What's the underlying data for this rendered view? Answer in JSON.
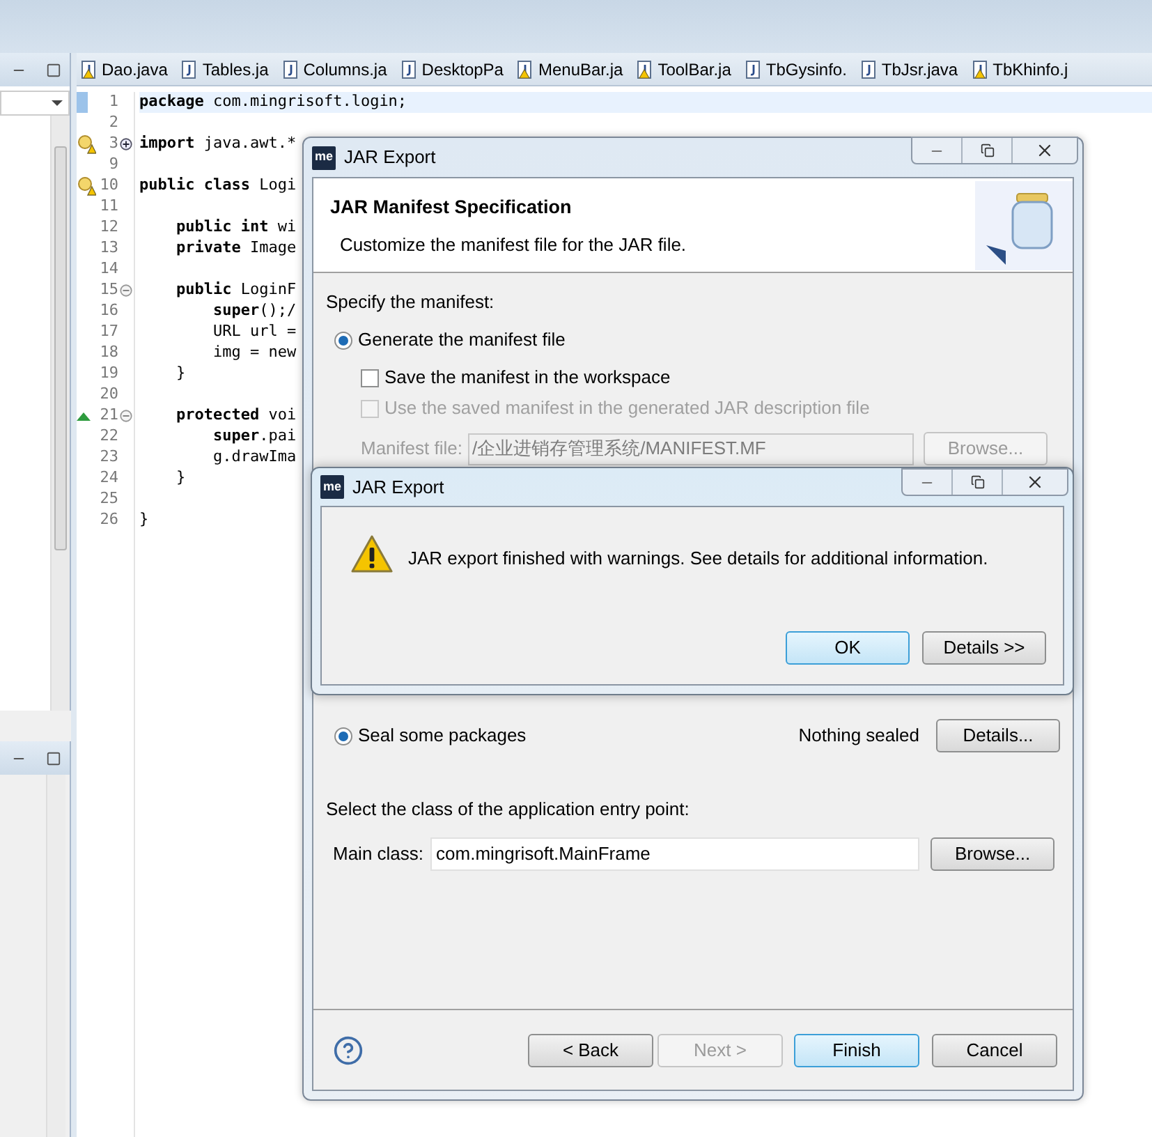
{
  "editor": {
    "tabs": [
      {
        "label": "Dao.java",
        "warning": true
      },
      {
        "label": "Tables.ja",
        "warning": false
      },
      {
        "label": "Columns.ja",
        "warning": false
      },
      {
        "label": "DesktopPa",
        "warning": false
      },
      {
        "label": "MenuBar.ja",
        "warning": true
      },
      {
        "label": "ToolBar.ja",
        "warning": true
      },
      {
        "label": "TbGysinfo.",
        "warning": false
      },
      {
        "label": "TbJsr.java",
        "warning": false
      },
      {
        "label": "TbKhinfo.j",
        "warning": true
      }
    ],
    "lines": [
      {
        "number": "1",
        "code": "**package** com.mingrisoft.login;",
        "highlighted": true,
        "warning": false,
        "override": false
      },
      {
        "number": "2",
        "highlighted": false,
        "warning": false,
        "override": false
      },
      {
        "number": "3",
        "code": "**import** java.awt.*",
        "highlighted": false,
        "warning": true,
        "override": false,
        "expanded": false
      },
      {
        "number": "9",
        "highlighted": false,
        "warning": false,
        "override": false
      },
      {
        "number": "10",
        "code": "**public class** Logi",
        "highlighted": false,
        "warning": true,
        "override": false
      },
      {
        "number": "11",
        "highlighted": false,
        "warning": false,
        "override": false
      },
      {
        "number": "12",
        "code": "    **public int** wi",
        "highlighted": false,
        "warning": false,
        "override": false
      },
      {
        "number": "13",
        "code": "    **private** Image",
        "highlighted": false,
        "warning": false,
        "override": false
      },
      {
        "number": "14",
        "highlighted": false,
        "warning": false,
        "override": false
      },
      {
        "number": "15",
        "code": "    **public** LoginF",
        "highlighted": false,
        "warning": false,
        "override": false,
        "expanded": true
      },
      {
        "number": "16",
        "code": "        **super**();/",
        "highlighted": false,
        "warning": false,
        "override": false
      },
      {
        "number": "17",
        "code": "        URL url =",
        "highlighted": false,
        "warning": false,
        "override": false
      },
      {
        "number": "18",
        "code": "        img = new",
        "highlighted": false,
        "warning": false,
        "override": false
      },
      {
        "number": "19",
        "code": "    }",
        "highlighted": false,
        "warning": false,
        "override": false
      },
      {
        "number": "20",
        "highlighted": false,
        "warning": false,
        "override": false
      },
      {
        "number": "21",
        "code": "    **protected** voi",
        "highlighted": false,
        "warning": false,
        "override": true,
        "expanded": true
      },
      {
        "number": "22",
        "code": "        **super**.pai",
        "highlighted": false,
        "warning": false,
        "override": false
      },
      {
        "number": "23",
        "code": "        g.drawIma",
        "highlighted": false,
        "warning": false,
        "override": false
      },
      {
        "number": "24",
        "code": "    }",
        "highlighted": false,
        "warning": false,
        "override": false
      },
      {
        "number": "25",
        "highlighted": false,
        "warning": false,
        "override": false
      },
      {
        "number": "26",
        "code": "}",
        "highlighted": false,
        "warning": false,
        "override": false
      }
    ]
  },
  "export_dialog": {
    "app_logo": "me",
    "title": "JAR Export",
    "heading": "JAR Manifest Specification",
    "description": "Customize the manifest file for the JAR file.",
    "section_label": "Specify the manifest:",
    "generate_option": {
      "label": "Generate the manifest file",
      "selected": true
    },
    "save_option": {
      "label": "Save the manifest in the workspace",
      "checked": false,
      "disabled": false
    },
    "reuse_option": {
      "label": "Use the saved manifest in the generated JAR description file",
      "checked": false,
      "disabled": true
    },
    "manifest_file": {
      "label": "Manifest file:",
      "value": "/企业进销存管理系统/MANIFEST.MF",
      "disabled": true,
      "browse": "Browse..."
    },
    "seal_option": {
      "label": "Seal some packages",
      "selected": true,
      "status": "Nothing sealed",
      "button": "Details..."
    },
    "entry_label": "Select the class of the application entry point:",
    "main_class": {
      "label": "Main class:",
      "value": "com.mingrisoft.MainFrame",
      "browse": "Browse..."
    },
    "buttons": [
      {
        "label": "< Back",
        "disabled": false,
        "default": false
      },
      {
        "label": "Next >",
        "disabled": true,
        "default": false
      },
      {
        "label": "Finish",
        "disabled": false,
        "default": true
      },
      {
        "label": "Cancel",
        "disabled": false,
        "default": false
      }
    ]
  },
  "message_dialog": {
    "app_logo": "me",
    "title": "JAR Export",
    "message": "JAR export finished with warnings. See details for additional information.",
    "buttons": [
      {
        "label": "OK",
        "default": true
      },
      {
        "label": "Details >>",
        "default": false
      }
    ]
  }
}
